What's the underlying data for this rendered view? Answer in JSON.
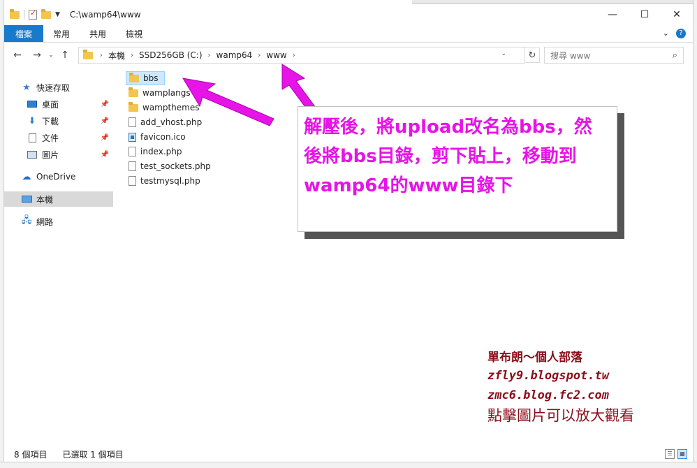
{
  "window": {
    "title": "C:\\wamp64\\www",
    "minimize": "—",
    "maximize": "☐",
    "close": "✕"
  },
  "ribbon": {
    "tabs": [
      "檔案",
      "常用",
      "共用",
      "檢視"
    ],
    "collapse": "⌄",
    "help": "?"
  },
  "address": {
    "crumbs": [
      "本機",
      "SSD256GB (C:)",
      "wamp64",
      "www"
    ],
    "search_placeholder": "搜尋 www"
  },
  "nav": {
    "items": [
      {
        "label": "快速存取",
        "icon": "star-icon"
      },
      {
        "label": "桌面",
        "icon": "desktop-icon",
        "pinned": true
      },
      {
        "label": "下載",
        "icon": "download-icon",
        "pinned": true
      },
      {
        "label": "文件",
        "icon": "document-icon",
        "pinned": true
      },
      {
        "label": "圖片",
        "icon": "picture-icon",
        "pinned": true
      },
      {
        "label": "OneDrive",
        "icon": "cloud-icon"
      },
      {
        "label": "本機",
        "icon": "computer-icon",
        "selected": true
      },
      {
        "label": "網路",
        "icon": "network-icon"
      }
    ]
  },
  "files": [
    {
      "name": "bbs",
      "type": "folder",
      "selected": true
    },
    {
      "name": "wamplangs",
      "type": "folder"
    },
    {
      "name": "wampthemes",
      "type": "folder"
    },
    {
      "name": "add_vhost.php",
      "type": "file"
    },
    {
      "name": "favicon.ico",
      "type": "ico"
    },
    {
      "name": "index.php",
      "type": "file"
    },
    {
      "name": "test_sockets.php",
      "type": "file"
    },
    {
      "name": "testmysql.php",
      "type": "file"
    }
  ],
  "annotation": {
    "line1": "解壓後，將upload改名為bbs，然",
    "line2": "後將bbs目錄，剪下貼上，移動到",
    "line3": "wamp64的www目錄下",
    "arrow_color": "#e614e6"
  },
  "watermark": {
    "line1": "單布朗～個人部落",
    "line2": "zfly9.blogspot.tw",
    "line3": "zmc6.blog.fc2.com",
    "line4": "點擊圖片可以放大觀看"
  },
  "status": {
    "count": "8 個項目",
    "selected": "已選取 1 個項目"
  }
}
